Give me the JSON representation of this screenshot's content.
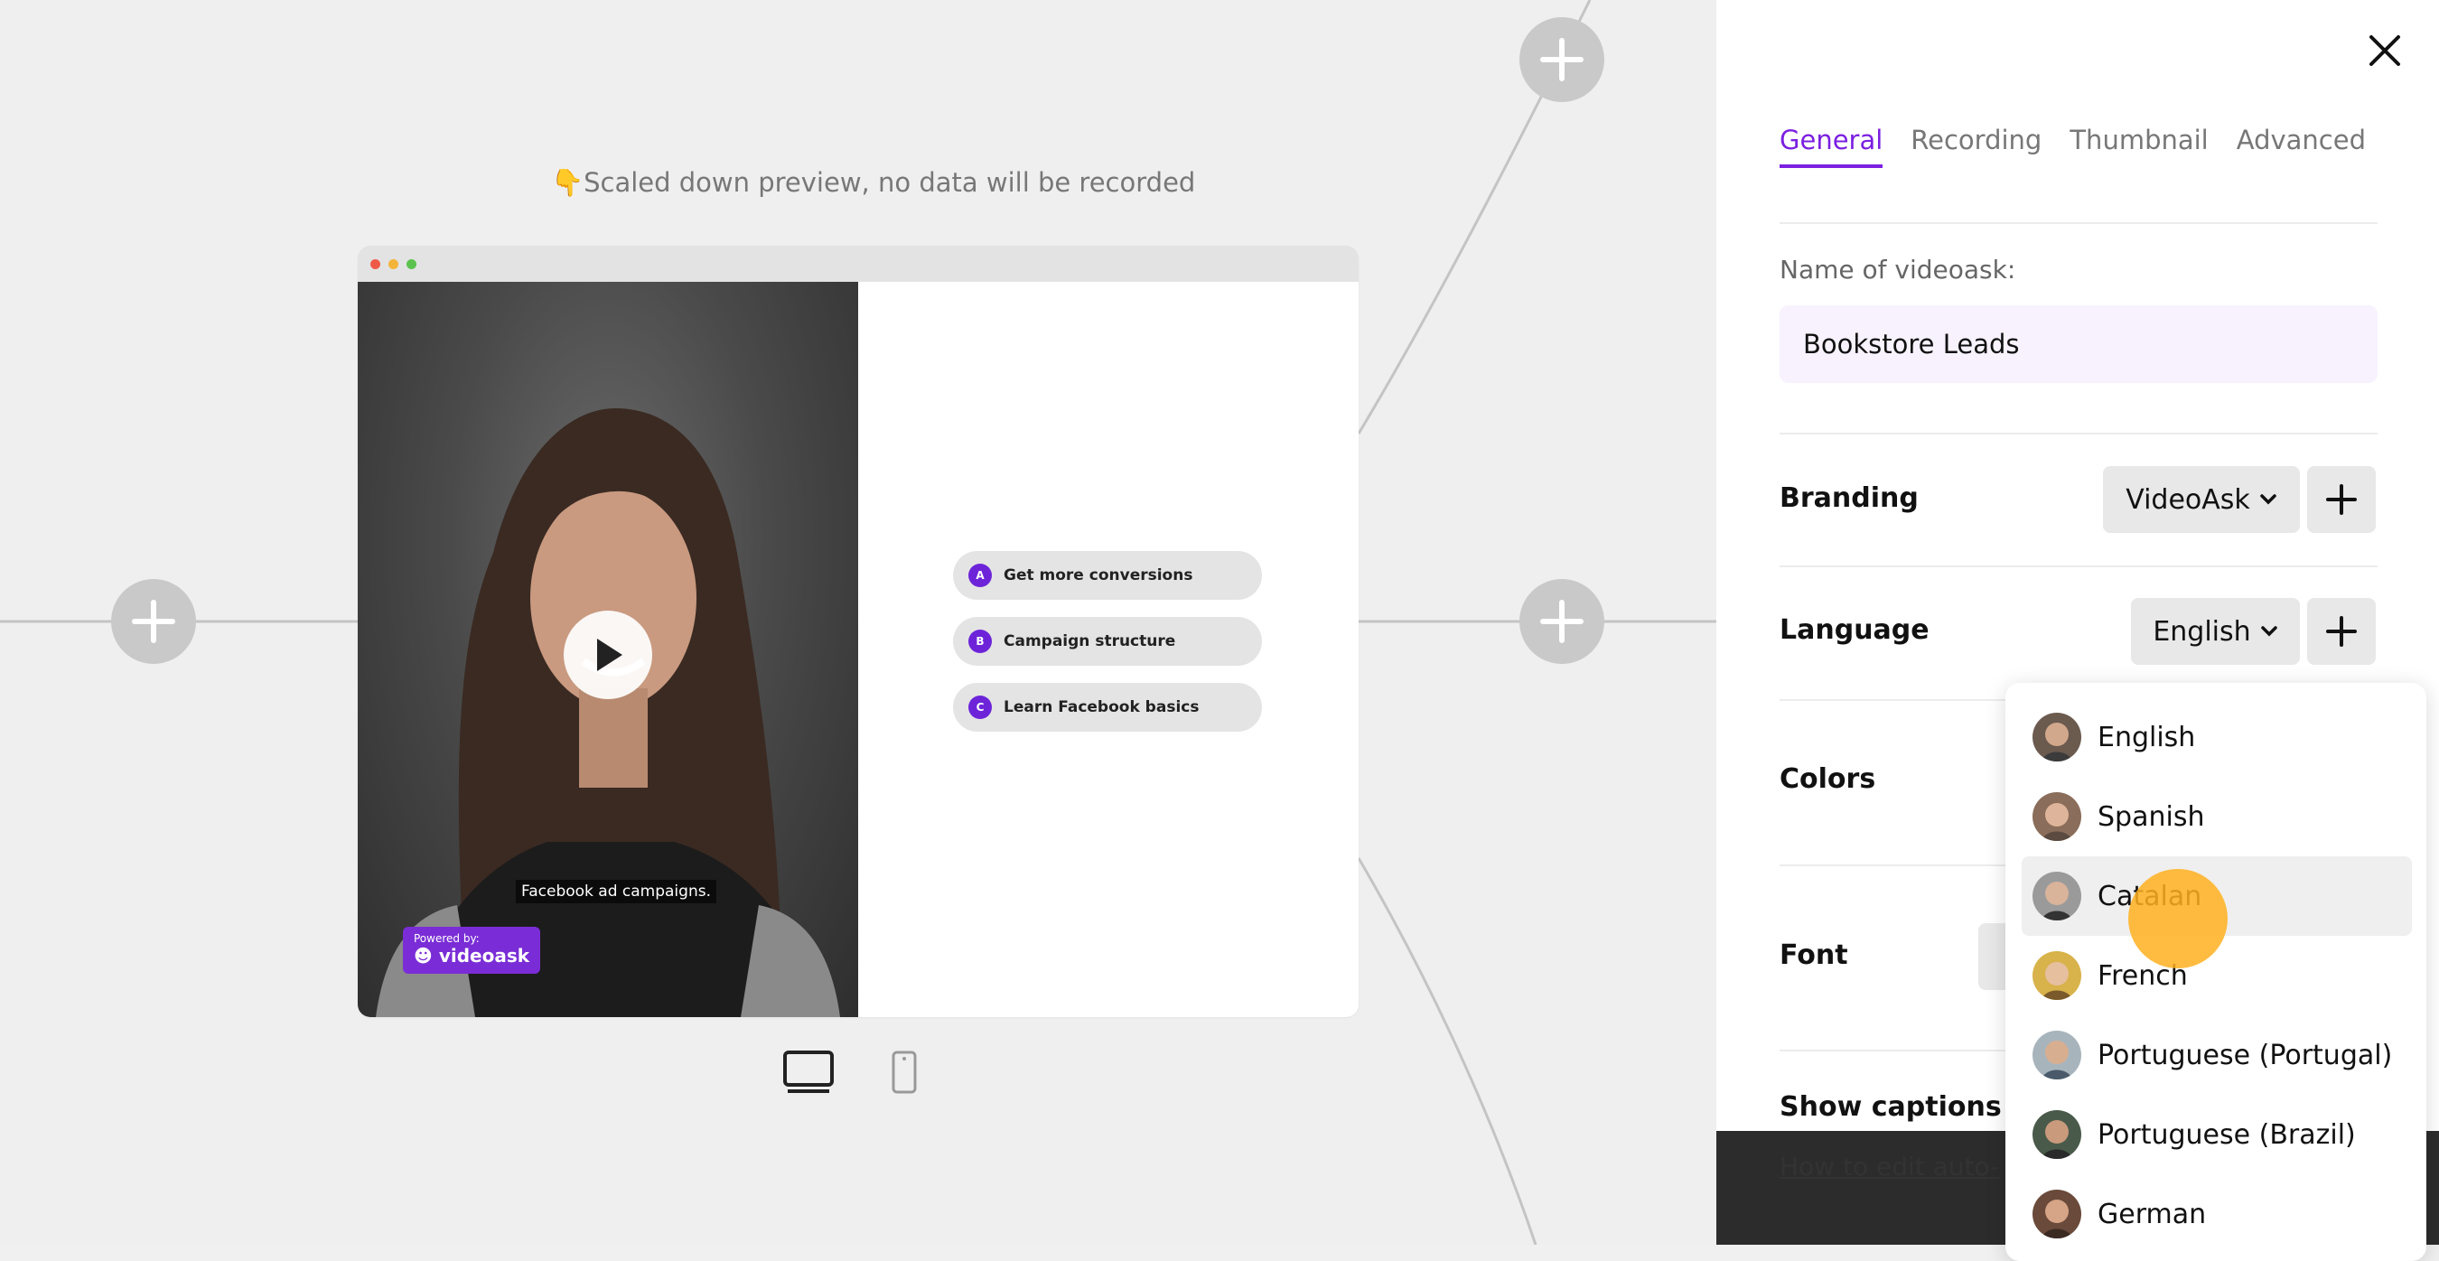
{
  "preview": {
    "note": "👇Scaled down preview, no data will be recorded",
    "caption": "Facebook ad campaigns.",
    "powered_small": "Powered by:",
    "powered_brand": "videoask",
    "choices": [
      {
        "letter": "A",
        "label": "Get more conversions"
      },
      {
        "letter": "B",
        "label": "Campaign structure"
      },
      {
        "letter": "C",
        "label": "Learn Facebook basics"
      }
    ]
  },
  "panel": {
    "tabs": [
      "General",
      "Recording",
      "Thumbnail",
      "Advanced"
    ],
    "active_tab": "General",
    "name_label": "Name of videoask:",
    "name_value": "Bookstore Leads",
    "branding_label": "Branding",
    "branding_value": "VideoAsk",
    "language_label": "Language",
    "language_value": "English",
    "colors_label": "Colors",
    "font_label": "Font",
    "captions_label": "Show captions by",
    "footer_link": "How to edit auto-"
  },
  "language_options": [
    "English",
    "Spanish",
    "Catalan",
    "French",
    "Portuguese (Portugal)",
    "Portuguese (Brazil)",
    "German"
  ],
  "hovered_option": "Catalan",
  "colors": {
    "accent": "#7b1fe0",
    "choice_letter": "#6d24d9",
    "cursor": "#ffb01e"
  },
  "icons": [
    "plus-icon",
    "play-icon",
    "desktop-icon",
    "mobile-icon",
    "close-icon",
    "chevron-down-icon"
  ]
}
